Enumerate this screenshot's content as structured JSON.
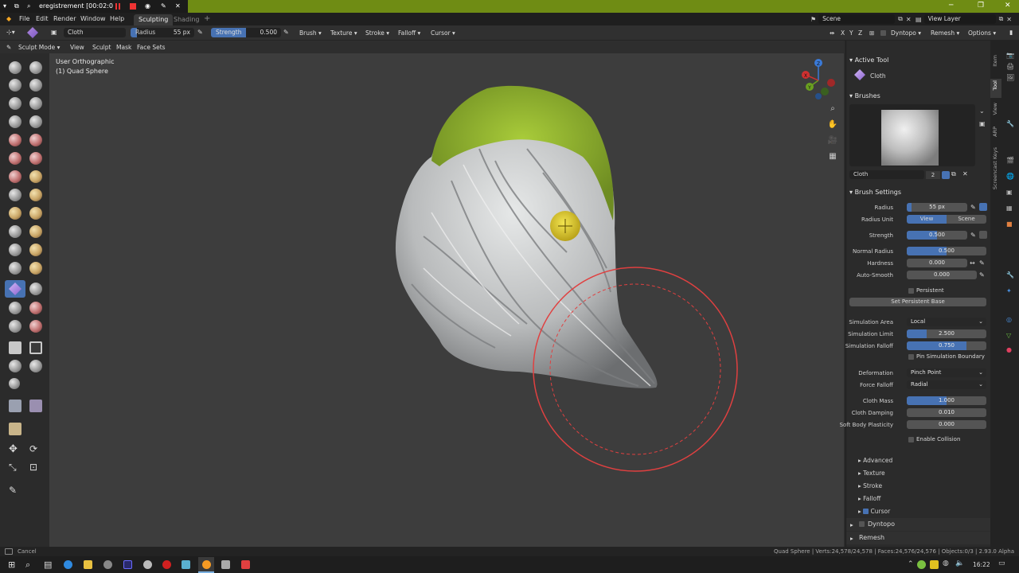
{
  "titlebar": {
    "title": "eregistrement [00:02:0"
  },
  "menubar": {
    "menus": [
      "File",
      "Edit",
      "Render",
      "Window",
      "Help"
    ],
    "workspaces": [
      "Sculpting",
      "Shading"
    ],
    "add_tab": "+",
    "scene": "Scene",
    "view_layer": "View Layer"
  },
  "toolheader": {
    "brush_name": "Cloth",
    "radius_label": "Radius",
    "radius_value": "55 px",
    "strength_label": "Strength",
    "strength_value": "0.500",
    "menus": [
      "Brush",
      "Texture",
      "Stroke",
      "Falloff",
      "Cursor"
    ],
    "axes": [
      "X",
      "Y",
      "Z"
    ],
    "dyntopo": "Dyntopo",
    "remesh": "Remesh",
    "options": "Options"
  },
  "moderow": {
    "mode": "Sculpt Mode",
    "menus": [
      "View",
      "Sculpt",
      "Mask",
      "Face Sets"
    ]
  },
  "viewport": {
    "view_name": "User Orthographic",
    "object_name": "(1) Quad Sphere",
    "gizmo_axes": {
      "x": "X",
      "y": "Y",
      "z": "Z"
    },
    "mesh_colors": {
      "body": "#c9cbcc",
      "mask": "#92b832",
      "cursor": "#e04040",
      "pointer": "#e6d020"
    }
  },
  "properties": {
    "active_tool_head": "Active Tool",
    "active_tool_name": "Cloth",
    "brushes_head": "Brushes",
    "brush_name": "Cloth",
    "brush_users": "2",
    "brush_settings_head": "Brush Settings",
    "radius_label": "Radius",
    "radius_value": "55 px",
    "radius_unit_label": "Radius Unit",
    "radius_unit_view": "View",
    "radius_unit_scene": "Scene",
    "strength_label": "Strength",
    "strength_value": "0.500",
    "strength_fraction": 0.5,
    "normal_radius_label": "Normal Radius",
    "normal_radius_value": "0.500",
    "normal_radius_fraction": 0.5,
    "hardness_label": "Hardness",
    "hardness_value": "0.000",
    "autosmooth_label": "Auto-Smooth",
    "autosmooth_value": "0.000",
    "persistent_label": "Persistent",
    "set_persistent_base": "Set Persistent Base",
    "sim_area_label": "Simulation Area",
    "sim_area_value": "Local",
    "sim_limit_label": "Simulation Limit",
    "sim_limit_value": "2.500",
    "sim_limit_fraction": 0.25,
    "sim_falloff_label": "Simulation Falloff",
    "sim_falloff_value": "0.750",
    "sim_falloff_fraction": 0.75,
    "pin_boundary_label": "Pin Simulation Boundary",
    "deformation_label": "Deformation",
    "deformation_value": "Pinch Point",
    "force_falloff_label": "Force Falloff",
    "force_falloff_value": "Radial",
    "cloth_mass_label": "Cloth Mass",
    "cloth_mass_value": "1.000",
    "cloth_mass_fraction": 0.5,
    "cloth_damping_label": "Cloth Damping",
    "cloth_damping_value": "0.010",
    "soft_body_label": "Soft Body Plasticity",
    "soft_body_value": "0.000",
    "enable_collision_label": "Enable Collision",
    "subpanels": [
      "Advanced",
      "Texture",
      "Stroke",
      "Falloff",
      "Cursor"
    ],
    "dyntopo": "Dyntopo",
    "remesh": "Remesh"
  },
  "tabs": [
    "Item",
    "Tool",
    "View",
    "ARP",
    "Screencast Keys"
  ],
  "status": {
    "left": "Cancel",
    "right": "Quad Sphere | Verts:24,578/24,578 | Faces:24,576/24,576 | Objects:0/3 | 2.93.0 Alpha"
  },
  "taskbar": {
    "time": "16:22"
  }
}
